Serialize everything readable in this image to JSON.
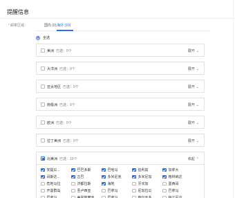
{
  "page": {
    "title": "提醒信息"
  },
  "field": {
    "required_mark": "*",
    "label": "邮寄区域："
  },
  "tabs": [
    {
      "label": "国内 (0)",
      "active": false
    },
    {
      "label": "海外 (10)",
      "active": true
    }
  ],
  "select_all": {
    "label": "全选"
  },
  "regions": [
    {
      "name": "美洲",
      "selected": "",
      "toggle": "展开",
      "expanded": false
    },
    {
      "name": "大洋洲",
      "selected": "已选：0个",
      "toggle": "展开",
      "expanded": false
    },
    {
      "name": "亚太地区",
      "selected": "已选：0个",
      "toggle": "展开",
      "expanded": false
    },
    {
      "name": "南极洲",
      "selected": "已选：0个",
      "toggle": "展开",
      "expanded": false
    },
    {
      "name": "欧洲",
      "selected": "已选：0个",
      "toggle": "展开",
      "expanded": false
    },
    {
      "name": "拉丁美洲",
      "selected": "已选：0个",
      "toggle": "展开",
      "expanded": false
    },
    {
      "name": "北美洲",
      "selected": "已选：10个",
      "toggle": "收起",
      "expanded": true
    }
  ],
  "region_first_selected_label": "已选：0个",
  "countries": [
    {
      "label": "安提瓜...",
      "checked": true
    },
    {
      "label": "巴巴多斯",
      "checked": true
    },
    {
      "label": "巴哈马",
      "checked": true
    },
    {
      "label": "伯利兹",
      "checked": true
    },
    {
      "label": "加拿大",
      "checked": true
    },
    {
      "label": "哥斯达...",
      "checked": true
    },
    {
      "label": "古巴",
      "checked": true
    },
    {
      "label": "多米尼克",
      "checked": true
    },
    {
      "label": "多米尼加",
      "checked": true
    },
    {
      "label": "格林纳达",
      "checked": true
    },
    {
      "label": "危地马拉",
      "checked": false
    },
    {
      "label": "洪都拉斯",
      "checked": false
    },
    {
      "label": "海地",
      "checked": true
    },
    {
      "label": "牙买加",
      "checked": false
    },
    {
      "label": "墨西哥",
      "checked": false
    },
    {
      "label": "开曼群岛",
      "checked": false
    },
    {
      "label": "圣卢西亚",
      "checked": false
    },
    {
      "label": "巴拿马",
      "checked": false
    },
    {
      "label": "尼加拉瓜",
      "checked": false
    },
    {
      "label": "巴拿马",
      "checked": false
    },
    {
      "label": "巴拿马",
      "checked": false
    },
    {
      "label": "美属萨摩亚",
      "checked": false
    },
    {
      "label": "巴拿马",
      "checked": false
    },
    {
      "label": "萨尔瓦多",
      "checked": false
    },
    {
      "label": "特立尼达",
      "checked": false
    }
  ],
  "colors": {
    "accent": "#2a6fdb",
    "border": "#e2e2e2",
    "required": "#f56c6c"
  },
  "icons": {
    "toggle": "chevron-down-icon",
    "expanded_toggle": "chevron-up-icon"
  }
}
